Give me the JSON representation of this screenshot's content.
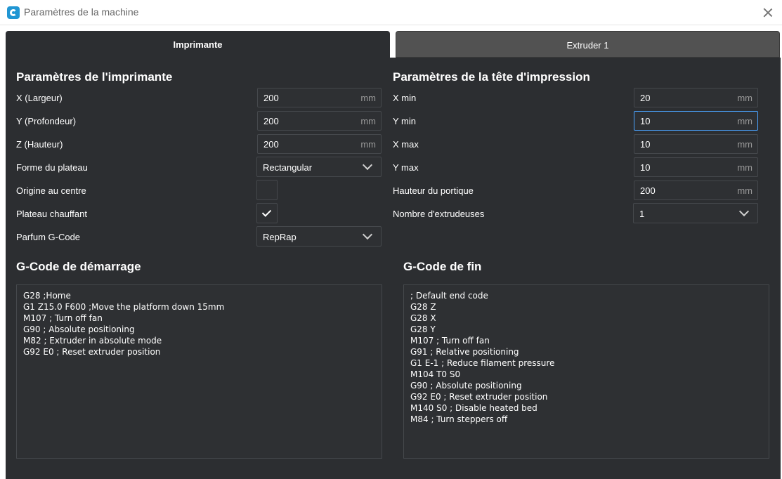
{
  "window": {
    "title": "Paramètres de la machine",
    "icon": "cura-logo-icon"
  },
  "tabs": [
    {
      "label": "Imprimante",
      "active": true
    },
    {
      "label": "Extruder 1",
      "active": false
    }
  ],
  "printer_settings": {
    "title": "Paramètres de l'imprimante",
    "x_label": "X (Largeur)",
    "x_value": "200",
    "x_unit": "mm",
    "y_label": "Y (Profondeur)",
    "y_value": "200",
    "y_unit": "mm",
    "z_label": "Z (Hauteur)",
    "z_value": "200",
    "z_unit": "mm",
    "bed_shape_label": "Forme du plateau",
    "bed_shape_value": "Rectangular",
    "origin_center_label": "Origine au centre",
    "origin_center_checked": false,
    "heated_bed_label": "Plateau chauffant",
    "heated_bed_checked": true,
    "gcode_flavor_label": "Parfum G-Code",
    "gcode_flavor_value": "RepRap"
  },
  "printhead_settings": {
    "title": "Paramètres de la tête d'impression",
    "xmin_label": "X min",
    "xmin_value": "20",
    "xmin_unit": "mm",
    "ymin_label": "Y min",
    "ymin_value": "10",
    "ymin_unit": "mm",
    "xmax_label": "X max",
    "xmax_value": "10",
    "xmax_unit": "mm",
    "ymax_label": "Y max",
    "ymax_value": "10",
    "ymax_unit": "mm",
    "gantry_label": "Hauteur du portique",
    "gantry_value": "200",
    "gantry_unit": "mm",
    "extruders_label": "Nombre d'extrudeuses",
    "extruders_value": "1"
  },
  "start_gcode": {
    "title": "G-Code de démarrage",
    "lines": [
      "G28 ;Home",
      "G1 Z15.0 F600 ;Move the platform down 15mm",
      "M107 ; Turn off fan",
      "G90 ; Absolute positioning",
      "M82 ; Extruder in absolute mode",
      "G92 E0 ; Reset extruder position"
    ]
  },
  "end_gcode": {
    "title": "G-Code de fin",
    "lines": [
      "; Default end code",
      "G28 Z",
      "G28 X",
      "G28 Y",
      "M107 ; Turn off fan",
      "G91 ; Relative positioning",
      "G1 E-1 ; Reduce filament pressure",
      "M104 T0 S0",
      "G90 ; Absolute positioning",
      "G92 E0 ; Reset extruder position",
      "M140 S0 ; Disable heated bed",
      "M84 ; Turn steppers off"
    ]
  },
  "colors": {
    "panel": "#2c2e31",
    "field": "#2e3033",
    "border": "#45484c",
    "focus": "#4aa3ff",
    "inactive_tab": "#525252"
  }
}
